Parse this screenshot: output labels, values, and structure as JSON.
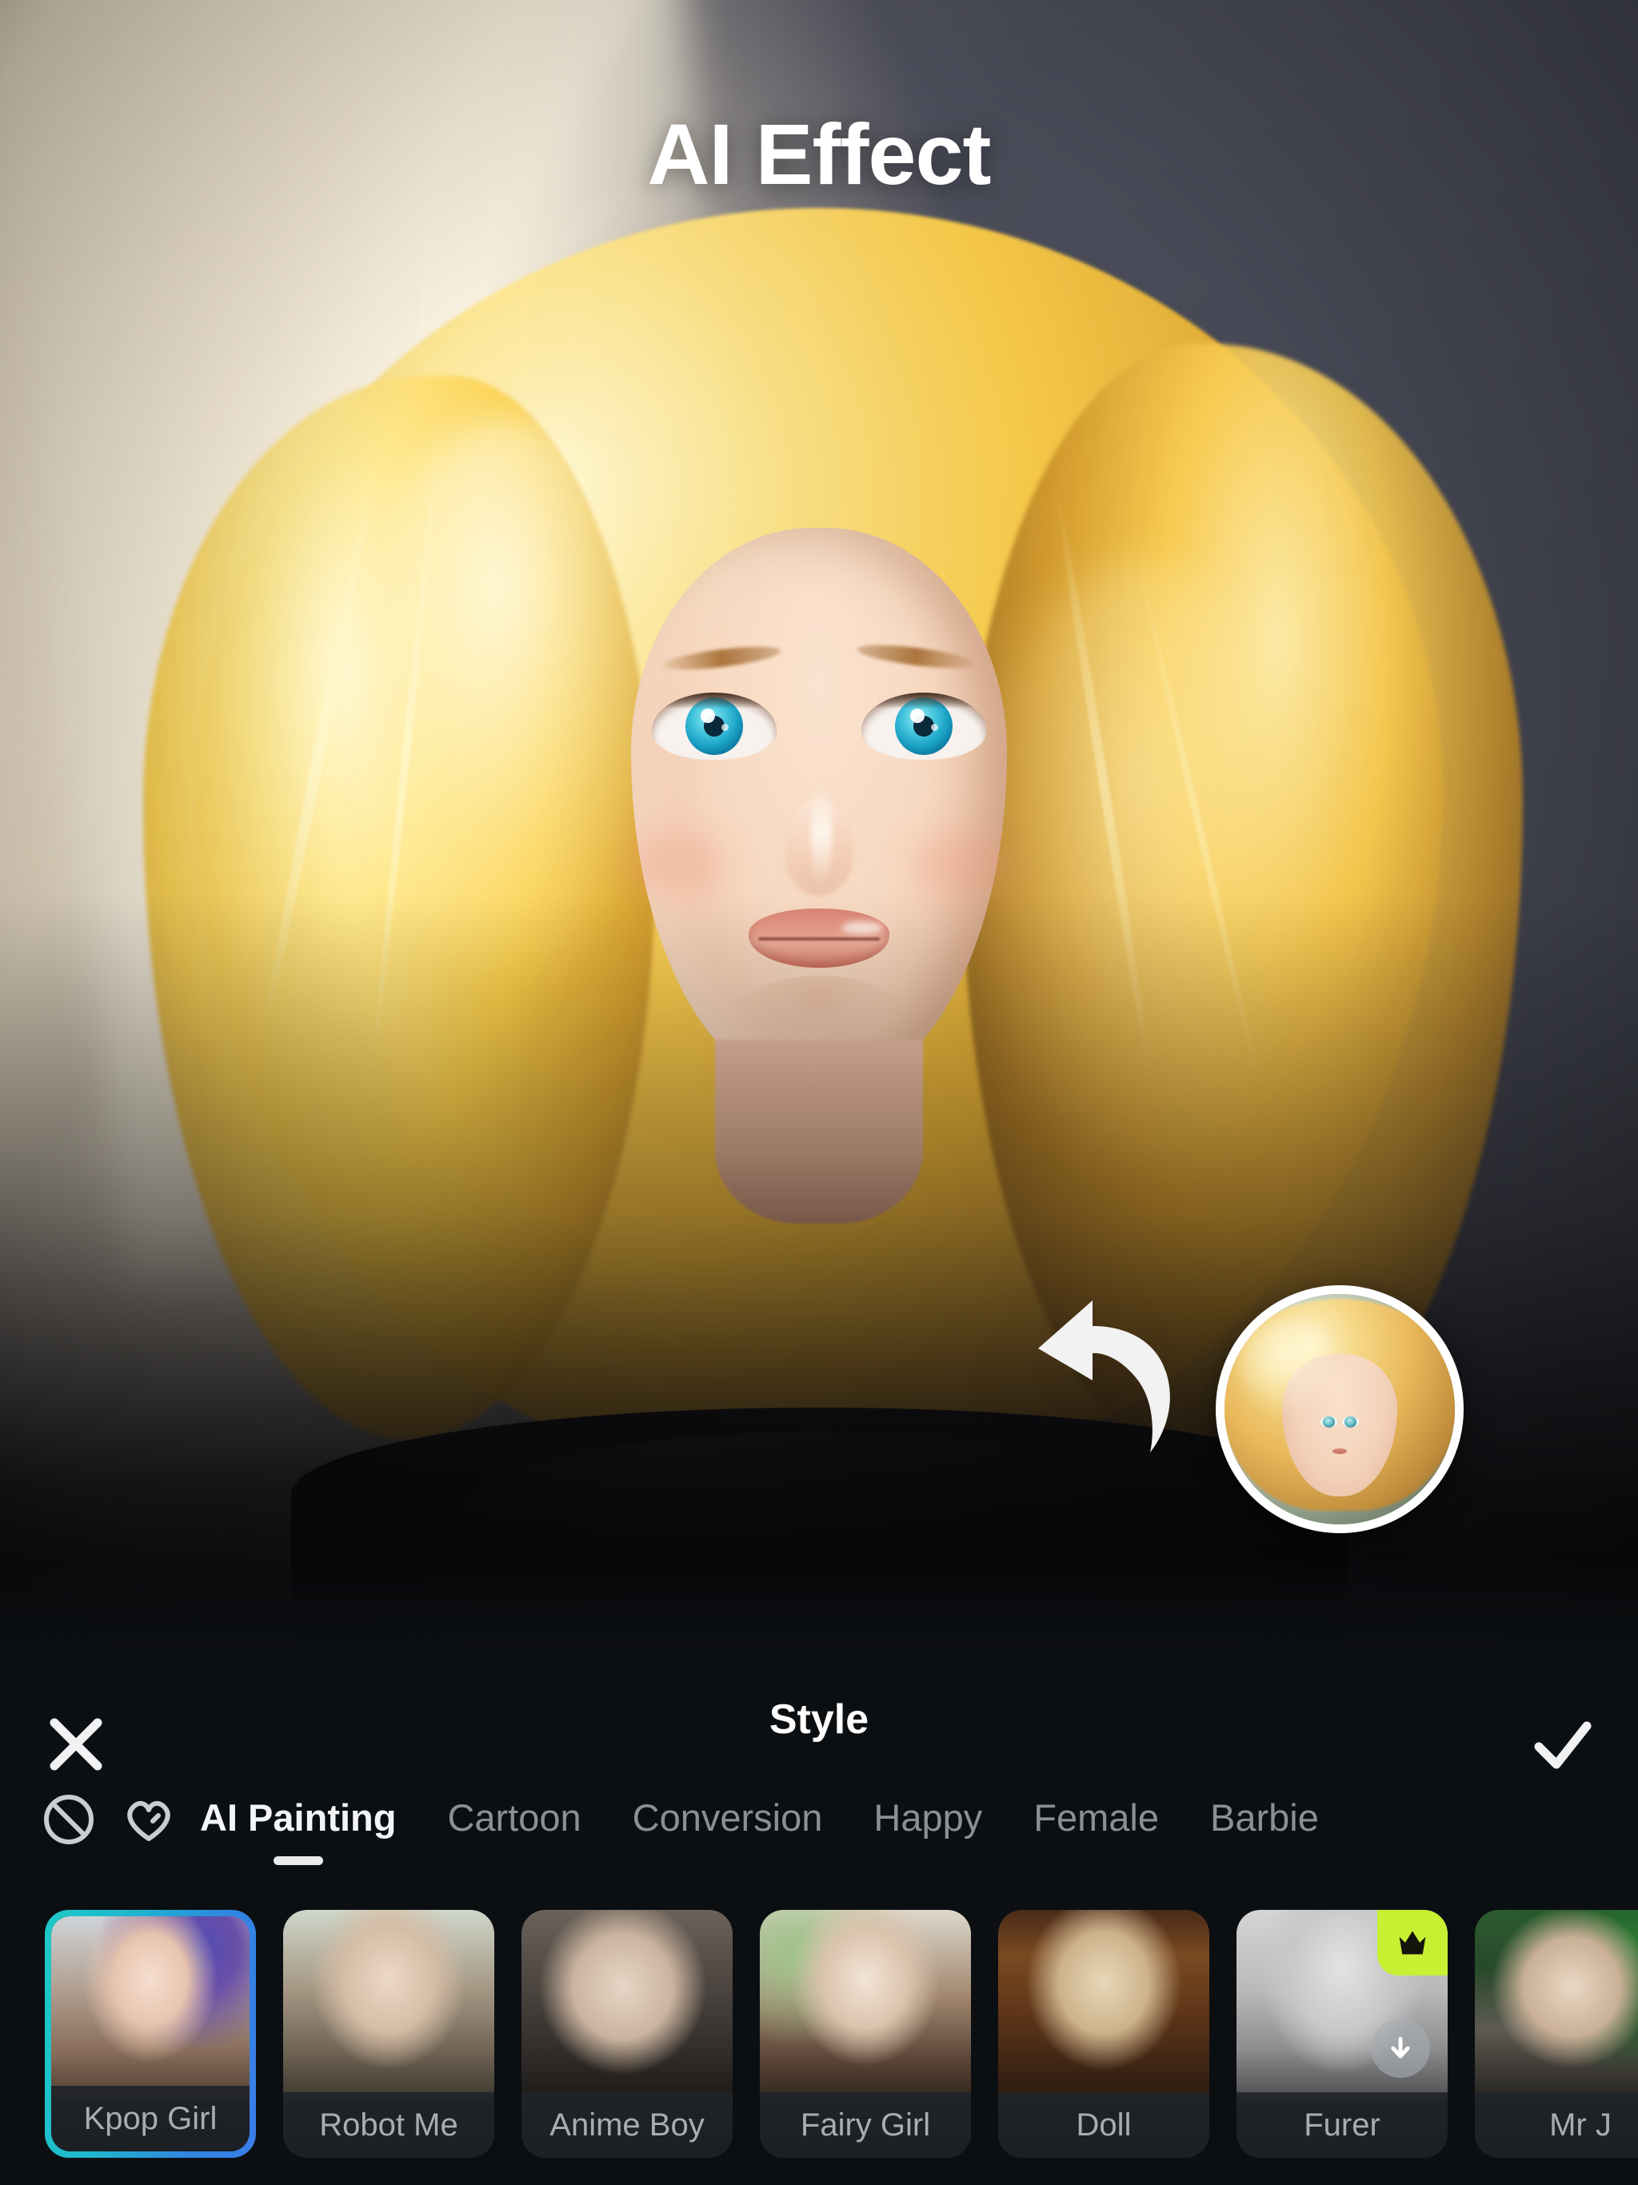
{
  "screen": {
    "title": "AI Effect"
  },
  "preview": {
    "result_image_alt": "ai-painting-result-portrait",
    "arrow_icon": "curved-arrow-up-left-icon",
    "original_thumbnail_alt": "original-photo-thumbnail"
  },
  "sheet": {
    "title": "Style",
    "close_icon": "close-icon",
    "confirm_icon": "check-icon"
  },
  "tabs": {
    "none_icon": "no-effect-icon",
    "favorite_icon": "heart-icon",
    "items": [
      {
        "label": "AI Painting",
        "active": true
      },
      {
        "label": "Cartoon",
        "active": false
      },
      {
        "label": "Conversion",
        "active": false
      },
      {
        "label": "Happy",
        "active": false
      },
      {
        "label": "Female",
        "active": false
      },
      {
        "label": "Barbie",
        "active": false
      }
    ]
  },
  "styles": [
    {
      "label": "Kpop Girl",
      "selected": true,
      "pro": false,
      "download": false,
      "art": "art-kpop"
    },
    {
      "label": "Robot Me",
      "selected": false,
      "pro": false,
      "download": false,
      "art": "art-robot"
    },
    {
      "label": "Anime Boy",
      "selected": false,
      "pro": false,
      "download": false,
      "art": "art-anime"
    },
    {
      "label": "Fairy Girl",
      "selected": false,
      "pro": false,
      "download": false,
      "art": "art-fairy"
    },
    {
      "label": "Doll",
      "selected": false,
      "pro": false,
      "download": false,
      "art": "art-doll"
    },
    {
      "label": "Furer",
      "selected": false,
      "pro": true,
      "download": true,
      "art": "art-furer"
    },
    {
      "label": "Mr J",
      "selected": false,
      "pro": false,
      "download": false,
      "art": "art-mrj"
    }
  ],
  "colors": {
    "sheet_background": "#0c0f12",
    "selected_border_start": "#1ec9c4",
    "selected_border_end": "#3b7de8",
    "pro_badge": "#c7f032",
    "active_tab_text": "#f2f4f6",
    "inactive_tab_text": "#8b9096"
  }
}
